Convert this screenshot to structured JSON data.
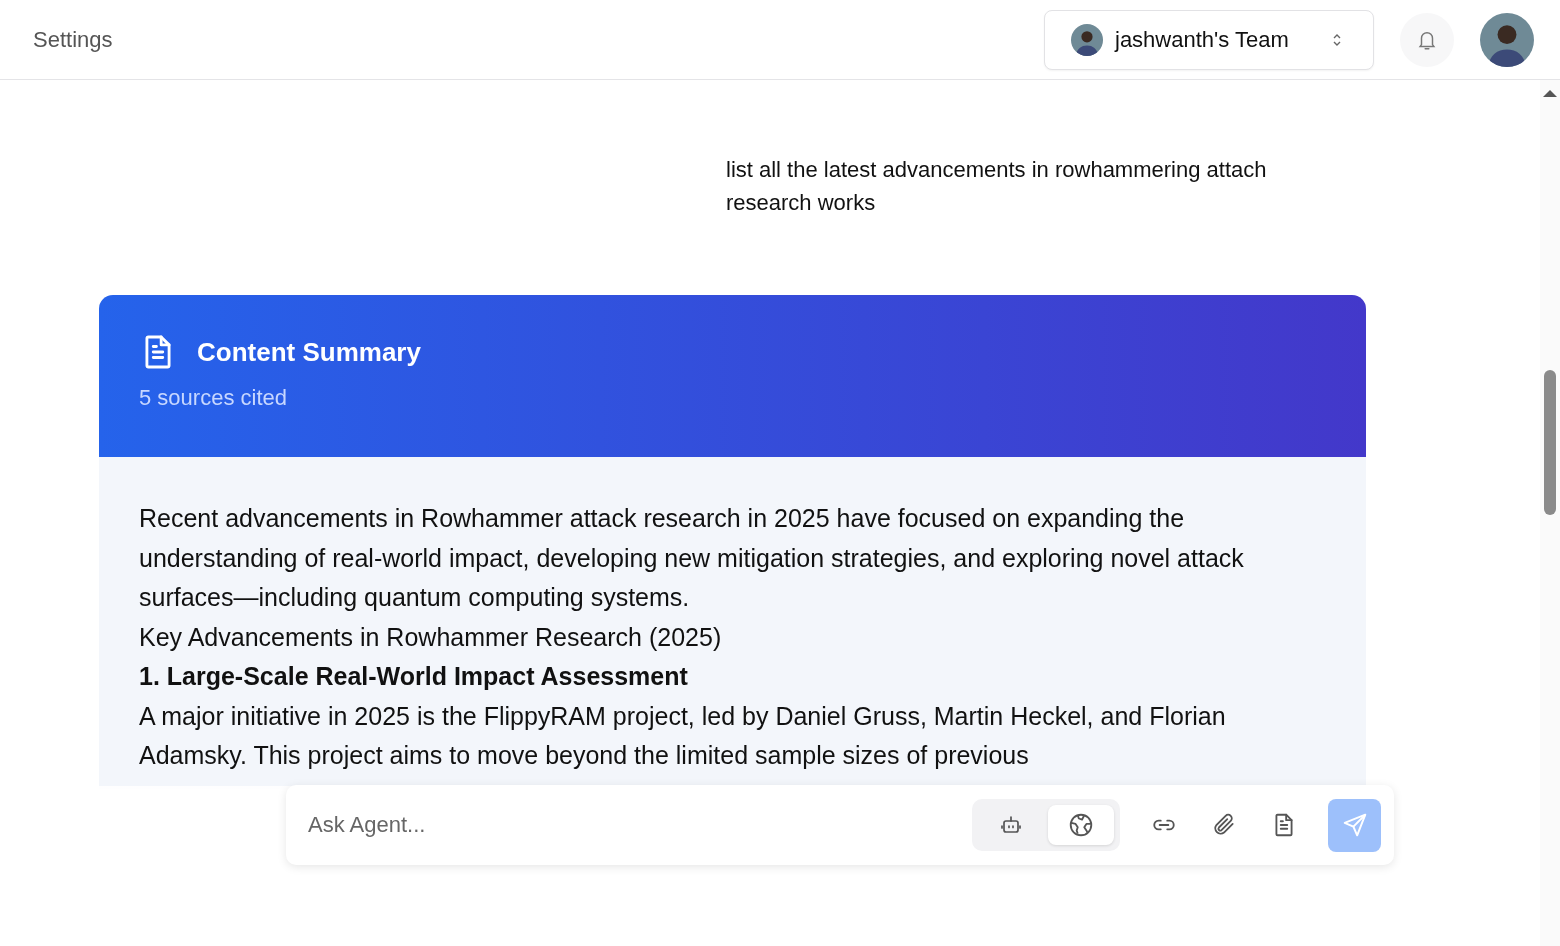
{
  "header": {
    "title": "Settings",
    "team": {
      "name": "jashwanth's Team"
    }
  },
  "user_message": {
    "text": "list all the latest advancements in rowhammering attach research works"
  },
  "summary": {
    "title": "Content Summary",
    "subtitle": "5 sources cited",
    "blocks": [
      {
        "kind": "paragraph",
        "text": "Recent advancements in Rowhammer attack research in 2025 have focused on expanding the understanding of real-world impact, developing new mitigation strategies, and exploring novel attack surfaces—including quantum computing systems."
      },
      {
        "kind": "paragraph",
        "text": "Key Advancements in Rowhammer Research (2025)"
      },
      {
        "kind": "heading",
        "text": "1. Large-Scale Real-World Impact Assessment"
      },
      {
        "kind": "paragraph",
        "text": "A major initiative in 2025 is the FlippyRAM project, led by Daniel Gruss, Martin Heckel, and Florian Adamsky. This project aims to move beyond the limited sample sizes of previous"
      }
    ]
  },
  "composer": {
    "placeholder": "Ask Agent...",
    "modes": [
      {
        "kind": "agent",
        "selected": false
      },
      {
        "kind": "web",
        "selected": true
      }
    ],
    "tools": [
      {
        "kind": "link"
      },
      {
        "kind": "attach"
      },
      {
        "kind": "document"
      }
    ],
    "send": {
      "disabled": true
    }
  }
}
